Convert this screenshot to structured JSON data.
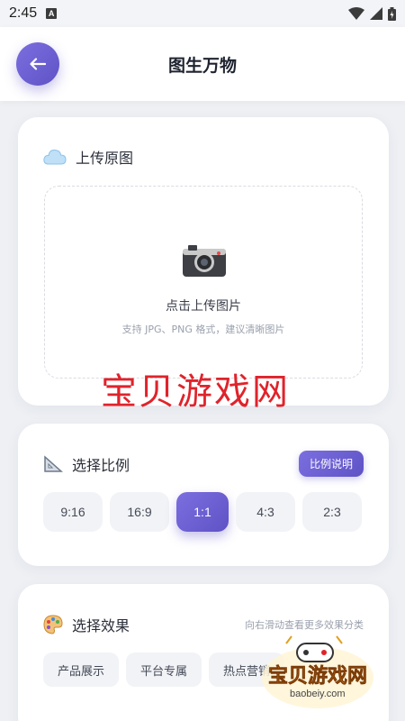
{
  "status_bar": {
    "time": "2:45",
    "notification_icon": "A"
  },
  "header": {
    "title": "图生万物",
    "back_icon": "back-arrow-icon"
  },
  "upload_section": {
    "title": "上传原图",
    "icon": "cloud-icon",
    "label": "点击上传图片",
    "hint": "支持 JPG、PNG 格式，建议清晰图片"
  },
  "ratio_section": {
    "title": "选择比例",
    "icon": "triangle-ruler-icon",
    "help_button": "比例说明",
    "options": [
      "9:16",
      "16:9",
      "1:1",
      "4:3",
      "2:3"
    ],
    "selected": "1:1"
  },
  "effect_section": {
    "title": "选择效果",
    "icon": "palette-icon",
    "hint": "向右滑动查看更多效果分类",
    "categories": [
      "产品展示",
      "平台专属",
      "热点营销"
    ]
  },
  "watermark": {
    "text": "宝贝游戏网"
  },
  "logo": {
    "text": "宝贝游戏网",
    "url": "baobeiy.com"
  },
  "colors": {
    "accent": "#6a5ed3",
    "background": "#eef0f4"
  }
}
